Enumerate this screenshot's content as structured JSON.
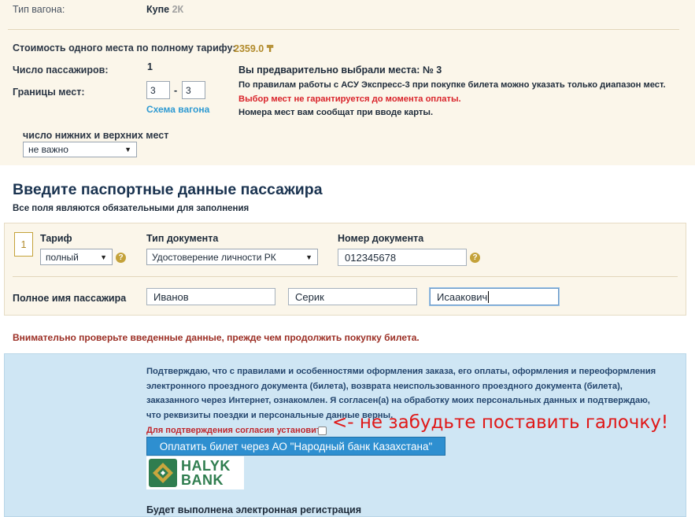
{
  "car": {
    "type_label": "Тип вагона:",
    "type_value": "Купе",
    "type_class": "2К"
  },
  "fare": {
    "price_label": "Стоимость одного места по полному тарифу:",
    "price_value": "2359.0 ₸",
    "passengers_label": "Число пассажиров:",
    "passengers_value": "1",
    "seat_range_label": "Границы мест:",
    "seat_from": "3",
    "seat_dash": "-",
    "seat_to": "3",
    "scheme_link": "Схема вагона",
    "berth_label": "число нижних и верхних мест",
    "berth_value": "не важно"
  },
  "info": {
    "chosen": "Вы предварительно выбрали места: № 3",
    "rule": "По правилам работы с АСУ Экспресс-3 при покупке билета можно указать только диапазон мест.",
    "warning": "Выбор мест не гарантируется до момента оплаты.",
    "note": "Номера мест вам сообщат при вводе карты."
  },
  "passport": {
    "heading": "Введите паспортные данные пассажира",
    "subheading": "Все поля являются обязательными для заполнения",
    "passenger_number": "1",
    "tariff_label": "Тариф",
    "tariff_value": "полный",
    "doc_type_label": "Тип документа",
    "doc_type_value": "Удостоверение личности РК",
    "doc_number_label": "Номер документа",
    "doc_number_value": "012345678",
    "fullname_label": "Полное имя пассажира",
    "last_name": "Иванов",
    "first_name": "Серик",
    "middle_name": "Исаакович",
    "help_glyph": "?"
  },
  "notice": "Внимательно проверьте введенные данные, прежде чем продолжить покупку билета.",
  "consent": {
    "text": "Подтверждаю, что с правилами и особенностями оформления заказа, его оплаты, оформления и переоформления электронного проездного документа (билета), возврата неиспользованного проездного документа (билета), заказанного через Интернет, ознакомлен. Я согласен(а) на обработку моих персональных данных и подтверждаю, что реквизиты поездки и персональные данные верны.",
    "agree_label": "Для подтверждения согласия установите",
    "agree_checked": false,
    "handwritten": "<- не забудьте поставить галочку!",
    "pay_button": "Оплатить билет через АО \"Народный банк Казахстана\"",
    "bank_logo_line1": "HALYK",
    "bank_logo_line2": "BANK",
    "registration": "Будет выполнена электронная регистрация"
  },
  "colors": {
    "tan_bg": "#fbf6ea",
    "blue_bg": "#cfe6f4",
    "accent_gold": "#c4a23a",
    "link_blue": "#2e9ad2",
    "warning_red": "#d9232a",
    "button_blue": "#2e8fd0",
    "bank_green": "#2f7d4f"
  }
}
